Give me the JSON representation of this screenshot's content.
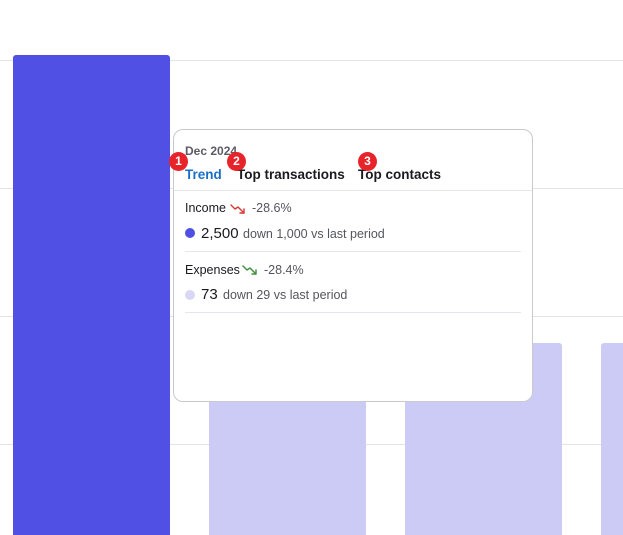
{
  "chart_data": {
    "type": "bar",
    "categories": [
      "",
      "",
      "",
      ""
    ],
    "values": [
      2500,
      1000,
      1000,
      1000
    ],
    "title": "",
    "xlabel": "",
    "ylabel": "",
    "grid": true
  },
  "colors": {
    "highlight_bar": "#5050e4",
    "muted_bar": "#cbcbf6",
    "active_tab": "#1b6fc8",
    "badge": "#e8242b",
    "trend_down_red": "#d93535",
    "trend_down_green": "#3f8f3f",
    "income_dot": "#5050e4",
    "expenses_dot": "#d8d8f6"
  },
  "tooltip": {
    "period": "Dec 2024",
    "tabs": [
      {
        "label": "Trend",
        "active": true
      },
      {
        "label": "Top transactions",
        "active": false
      },
      {
        "label": "Top contacts",
        "active": false
      }
    ],
    "income": {
      "label": "Income",
      "trend_icon": "trend-down-icon",
      "change_pct": "-28.6%",
      "value": "2,500",
      "delta": "down 1,000 vs last period"
    },
    "expenses": {
      "label": "Expenses",
      "trend_icon": "trend-down-icon",
      "change_pct": "-28.4%",
      "value": "73",
      "delta": "down 29 vs last period"
    }
  },
  "badges": [
    "1",
    "2",
    "3"
  ]
}
